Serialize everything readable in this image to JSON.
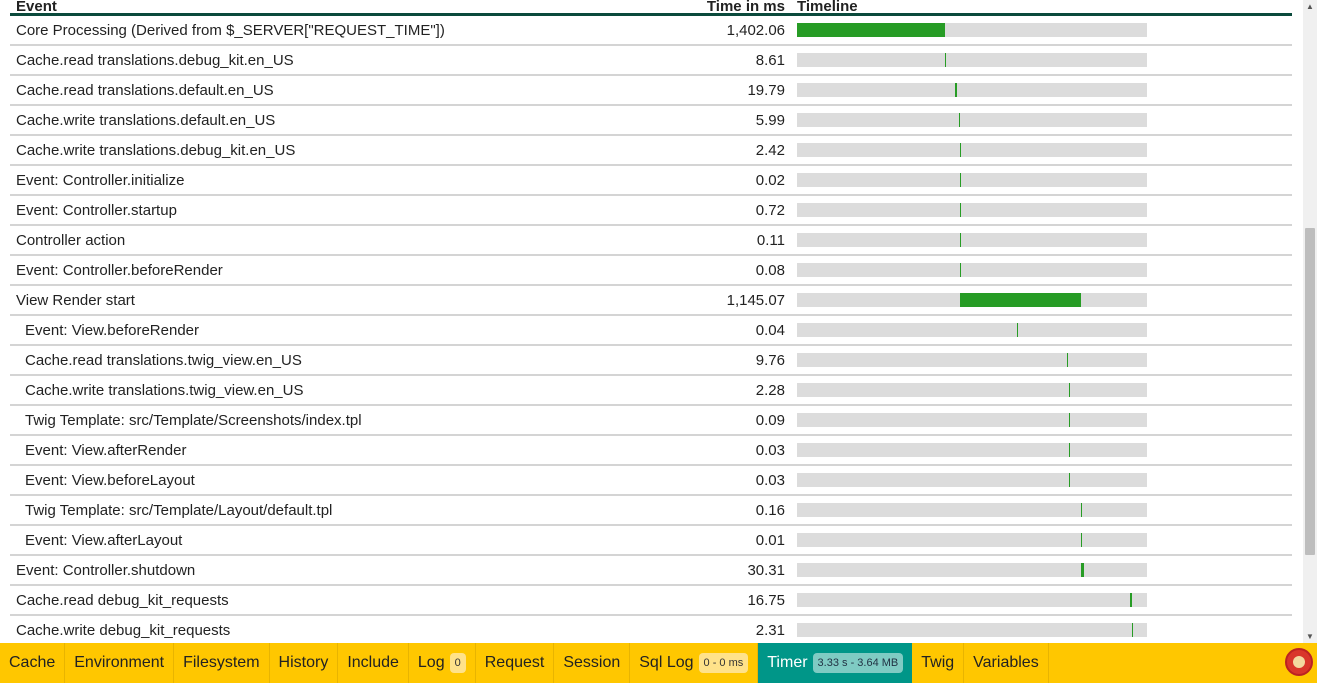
{
  "table": {
    "headers": {
      "event": "Event",
      "time": "Time in ms",
      "timeline": "Timeline"
    },
    "timeline_unit": "percent of total request time",
    "rows": [
      {
        "event": "Core Processing (Derived from $_SERVER[\"REQUEST_TIME\"])",
        "time": "1,402.06",
        "indent": false,
        "start": 0,
        "width": 42.3
      },
      {
        "event": "Cache.read translations.debug_kit.en_US",
        "time": "8.61",
        "indent": false,
        "start": 42.3,
        "width": 0.3
      },
      {
        "event": "Cache.read translations.default.en_US",
        "time": "19.79",
        "indent": false,
        "start": 45.1,
        "width": 0.6
      },
      {
        "event": "Cache.write translations.default.en_US",
        "time": "5.99",
        "indent": false,
        "start": 46.3,
        "width": 0.2
      },
      {
        "event": "Cache.write translations.debug_kit.en_US",
        "time": "2.42",
        "indent": false,
        "start": 46.6,
        "width": 0.1
      },
      {
        "event": "Event: Controller.initialize",
        "time": "0.02",
        "indent": false,
        "start": 46.6,
        "width": 0
      },
      {
        "event": "Event: Controller.startup",
        "time": "0.72",
        "indent": false,
        "start": 46.6,
        "width": 0
      },
      {
        "event": "Controller action",
        "time": "0.11",
        "indent": false,
        "start": 46.6,
        "width": 0
      },
      {
        "event": "Event: Controller.beforeRender",
        "time": "0.08",
        "indent": false,
        "start": 46.6,
        "width": 0
      },
      {
        "event": "View Render start",
        "time": "1,145.07",
        "indent": false,
        "start": 46.6,
        "width": 34.6
      },
      {
        "event": "Event: View.beforeRender",
        "time": "0.04",
        "indent": true,
        "start": 62.9,
        "width": 0
      },
      {
        "event": "Cache.read translations.twig_view.en_US",
        "time": "9.76",
        "indent": true,
        "start": 77.1,
        "width": 0.3
      },
      {
        "event": "Cache.write translations.twig_view.en_US",
        "time": "2.28",
        "indent": true,
        "start": 77.7,
        "width": 0.1
      },
      {
        "event": "Twig Template: src/Template/Screenshots/index.tpl",
        "time": "0.09",
        "indent": true,
        "start": 77.7,
        "width": 0
      },
      {
        "event": "Event: View.afterRender",
        "time": "0.03",
        "indent": true,
        "start": 77.7,
        "width": 0
      },
      {
        "event": "Event: View.beforeLayout",
        "time": "0.03",
        "indent": true,
        "start": 77.7,
        "width": 0
      },
      {
        "event": "Twig Template: src/Template/Layout/default.tpl",
        "time": "0.16",
        "indent": true,
        "start": 81.1,
        "width": 0
      },
      {
        "event": "Event: View.afterLayout",
        "time": "0.01",
        "indent": true,
        "start": 81.1,
        "width": 0
      },
      {
        "event": "Event: Controller.shutdown",
        "time": "30.31",
        "indent": false,
        "start": 81.1,
        "width": 0.9
      },
      {
        "event": "Cache.read debug_kit_requests",
        "time": "16.75",
        "indent": false,
        "start": 95.1,
        "width": 0.6
      },
      {
        "event": "Cache.write debug_kit_requests",
        "time": "2.31",
        "indent": false,
        "start": 95.7,
        "width": 0.1
      }
    ]
  },
  "toolbar": {
    "tabs": [
      {
        "label": "Cache"
      },
      {
        "label": "Environment"
      },
      {
        "label": "Filesystem"
      },
      {
        "label": "History"
      },
      {
        "label": "Include"
      },
      {
        "label": "Log",
        "badge": "0"
      },
      {
        "label": "Request"
      },
      {
        "label": "Session"
      },
      {
        "label": "Sql Log",
        "badge": "0 - 0 ms"
      },
      {
        "label": "Timer",
        "badge": "3.33 s - 3.64 MB",
        "active": true
      },
      {
        "label": "Twig"
      },
      {
        "label": "Variables"
      }
    ],
    "logo_icon": "cakephp-logo-icon"
  },
  "colors": {
    "bar": "#279c25",
    "track": "#dcdcdc",
    "toolbar": "#ffc700",
    "active_tab": "#009688",
    "header_rule": "#0b4a3c"
  }
}
